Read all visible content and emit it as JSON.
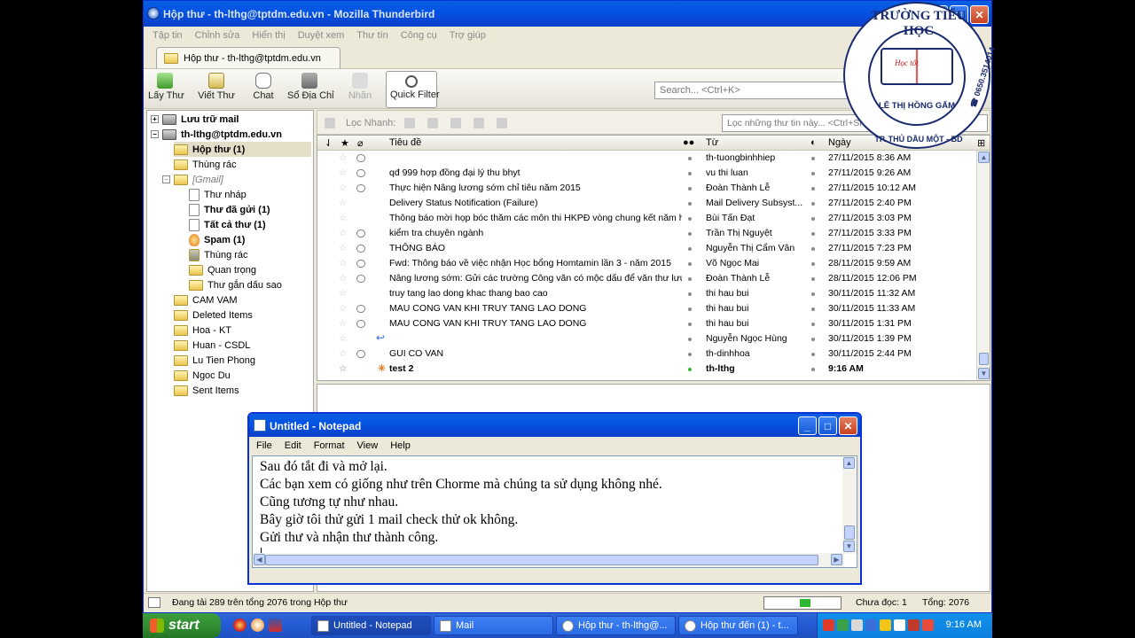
{
  "thunderbird": {
    "title": "Hộp thư - th-lthg@tptdm.edu.vn - Mozilla Thunderbird",
    "menu": [
      "Tập tin",
      "Chỉnh sửa",
      "Hiển thị",
      "Duyệt xem",
      "Thư tín",
      "Công cụ",
      "Trợ giúp"
    ],
    "tab_label": "Hộp thư - th-lthg@tptdm.edu.vn",
    "toolbar": {
      "get_mail": "Lấy Thư",
      "write": "Viết Thư",
      "chat": "Chat",
      "address_book": "Sổ Địa Chỉ",
      "tag": "Nhãn",
      "quick_filter": "Quick Filter"
    },
    "search_placeholder": "Search... <Ctrl+K>",
    "folders": [
      "Lưu trữ mail",
      "th-lthg@tptdm.edu.vn",
      "Hộp thư (1)",
      "Thùng rác",
      "[Gmail]",
      "Thư nháp",
      "Thư đã gửi (1)",
      "Tất cả thư (1)",
      "Spam (1)",
      "Thùng rác",
      "Quan trọng",
      "Thư gắn dấu sao",
      "CAM VAM",
      "Deleted Items",
      "Hoa - KT",
      "Huan - CSDL",
      "Lu Tien Phong",
      "Ngoc Du",
      "Sent Items"
    ],
    "quick_filter_label": "Lọc Nhanh:",
    "filter_placeholder": "Lọc những thư tin này... <Ctrl+Shift+K>",
    "columns": {
      "subject": "Tiêu đề",
      "from": "Từ",
      "date": "Ngày"
    },
    "messages": [
      {
        "subject": "",
        "from": "th-tuongbinhhiep",
        "date": "27/11/2015 8:36 AM"
      },
      {
        "subject": "qđ 999 hợp đồng đại lý thu bhyt",
        "from": "vu thi luan",
        "date": "27/11/2015 9:26 AM"
      },
      {
        "subject": "Thực hiện Nâng lương sớm chỉ tiêu năm 2015",
        "from": "Đoàn Thành Lễ",
        "date": "27/11/2015 10:12 AM"
      },
      {
        "subject": "Delivery Status Notification (Failure)",
        "from": "Mail Delivery Subsyst...",
        "date": "27/11/2015 2:40 PM"
      },
      {
        "subject": "Thông báo mời họp bóc thăm các môn thi HKPĐ vòng chung kết năm họ...",
        "from": "Bùi Tấn Đạt",
        "date": "27/11/2015 3:03 PM"
      },
      {
        "subject": "kiểm tra chuyên ngành",
        "from": "Trần Thị Nguyệt",
        "date": "27/11/2015 3:33 PM"
      },
      {
        "subject": "THÔNG BÁO",
        "from": "Nguyễn Thị Cẩm Vân",
        "date": "27/11/2015 7:23 PM"
      },
      {
        "subject": "Fwd: Thông báo về việc nhận Học bổng Homtamin lần 3 - năm 2015",
        "from": "Võ Ngọc Mai",
        "date": "28/11/2015 9:59 AM"
      },
      {
        "subject": "Nâng lương sớm: Gửi các trường Công văn có mộc dấu để văn thư lưu ...",
        "from": "Đoàn Thành Lễ",
        "date": "28/11/2015 12:06 PM"
      },
      {
        "subject": "truy tang lao dong khac thang bao cao",
        "from": "thi hau bui",
        "date": "30/11/2015 11:32 AM"
      },
      {
        "subject": "MAU CONG VAN KHI TRUY TANG LAO DONG",
        "from": "thi hau bui",
        "date": "30/11/2015 11:33 AM"
      },
      {
        "subject": "MAU CONG VAN KHI TRUY TANG LAO DONG",
        "from": "thi hau bui",
        "date": "30/11/2015 1:31 PM"
      },
      {
        "subject": "",
        "from": "Nguyễn Ngọc Hùng",
        "date": "30/11/2015 1:39 PM"
      },
      {
        "subject": "GUI CO VAN",
        "from": "th-dinhhoa",
        "date": "30/11/2015 2:44 PM"
      },
      {
        "subject": "test 2",
        "from": "th-lthg",
        "date": "9:16 AM"
      }
    ],
    "status": {
      "text": "Đang tải 289 trên tổng 2076 trong Hộp thư",
      "unread": "Chưa đọc: 1",
      "total": "Tổng: 2076",
      "progress": 0.139
    }
  },
  "notepad": {
    "title": "Untitled - Notepad",
    "menu": [
      "File",
      "Edit",
      "Format",
      "View",
      "Help"
    ],
    "content": "Sau đó tắt đi và mở lại.\nCác bạn xem có giống như trên Chorme mà chúng ta sử dụng không nhé.\nCũng tương tự như nhau.\nBây giờ tôi thử gửi 1 mail check thử ok không.\nGửi thư và nhận thư thành công."
  },
  "logo": {
    "top": "TRƯỜNG TIỂU HỌC",
    "name": "LÊ THỊ HỒNG GẤM",
    "bottom": "TP. THỦ DẦU MỘT - BD",
    "phone": "☎ 0650.3514014",
    "book_text": "Học tốt"
  },
  "taskbar": {
    "start": "start",
    "tasks": [
      "Untitled - Notepad",
      "Mail",
      "Hộp thư - th-lthg@...",
      "Hộp thư đến (1) - t..."
    ],
    "clock": "9:16 AM"
  }
}
